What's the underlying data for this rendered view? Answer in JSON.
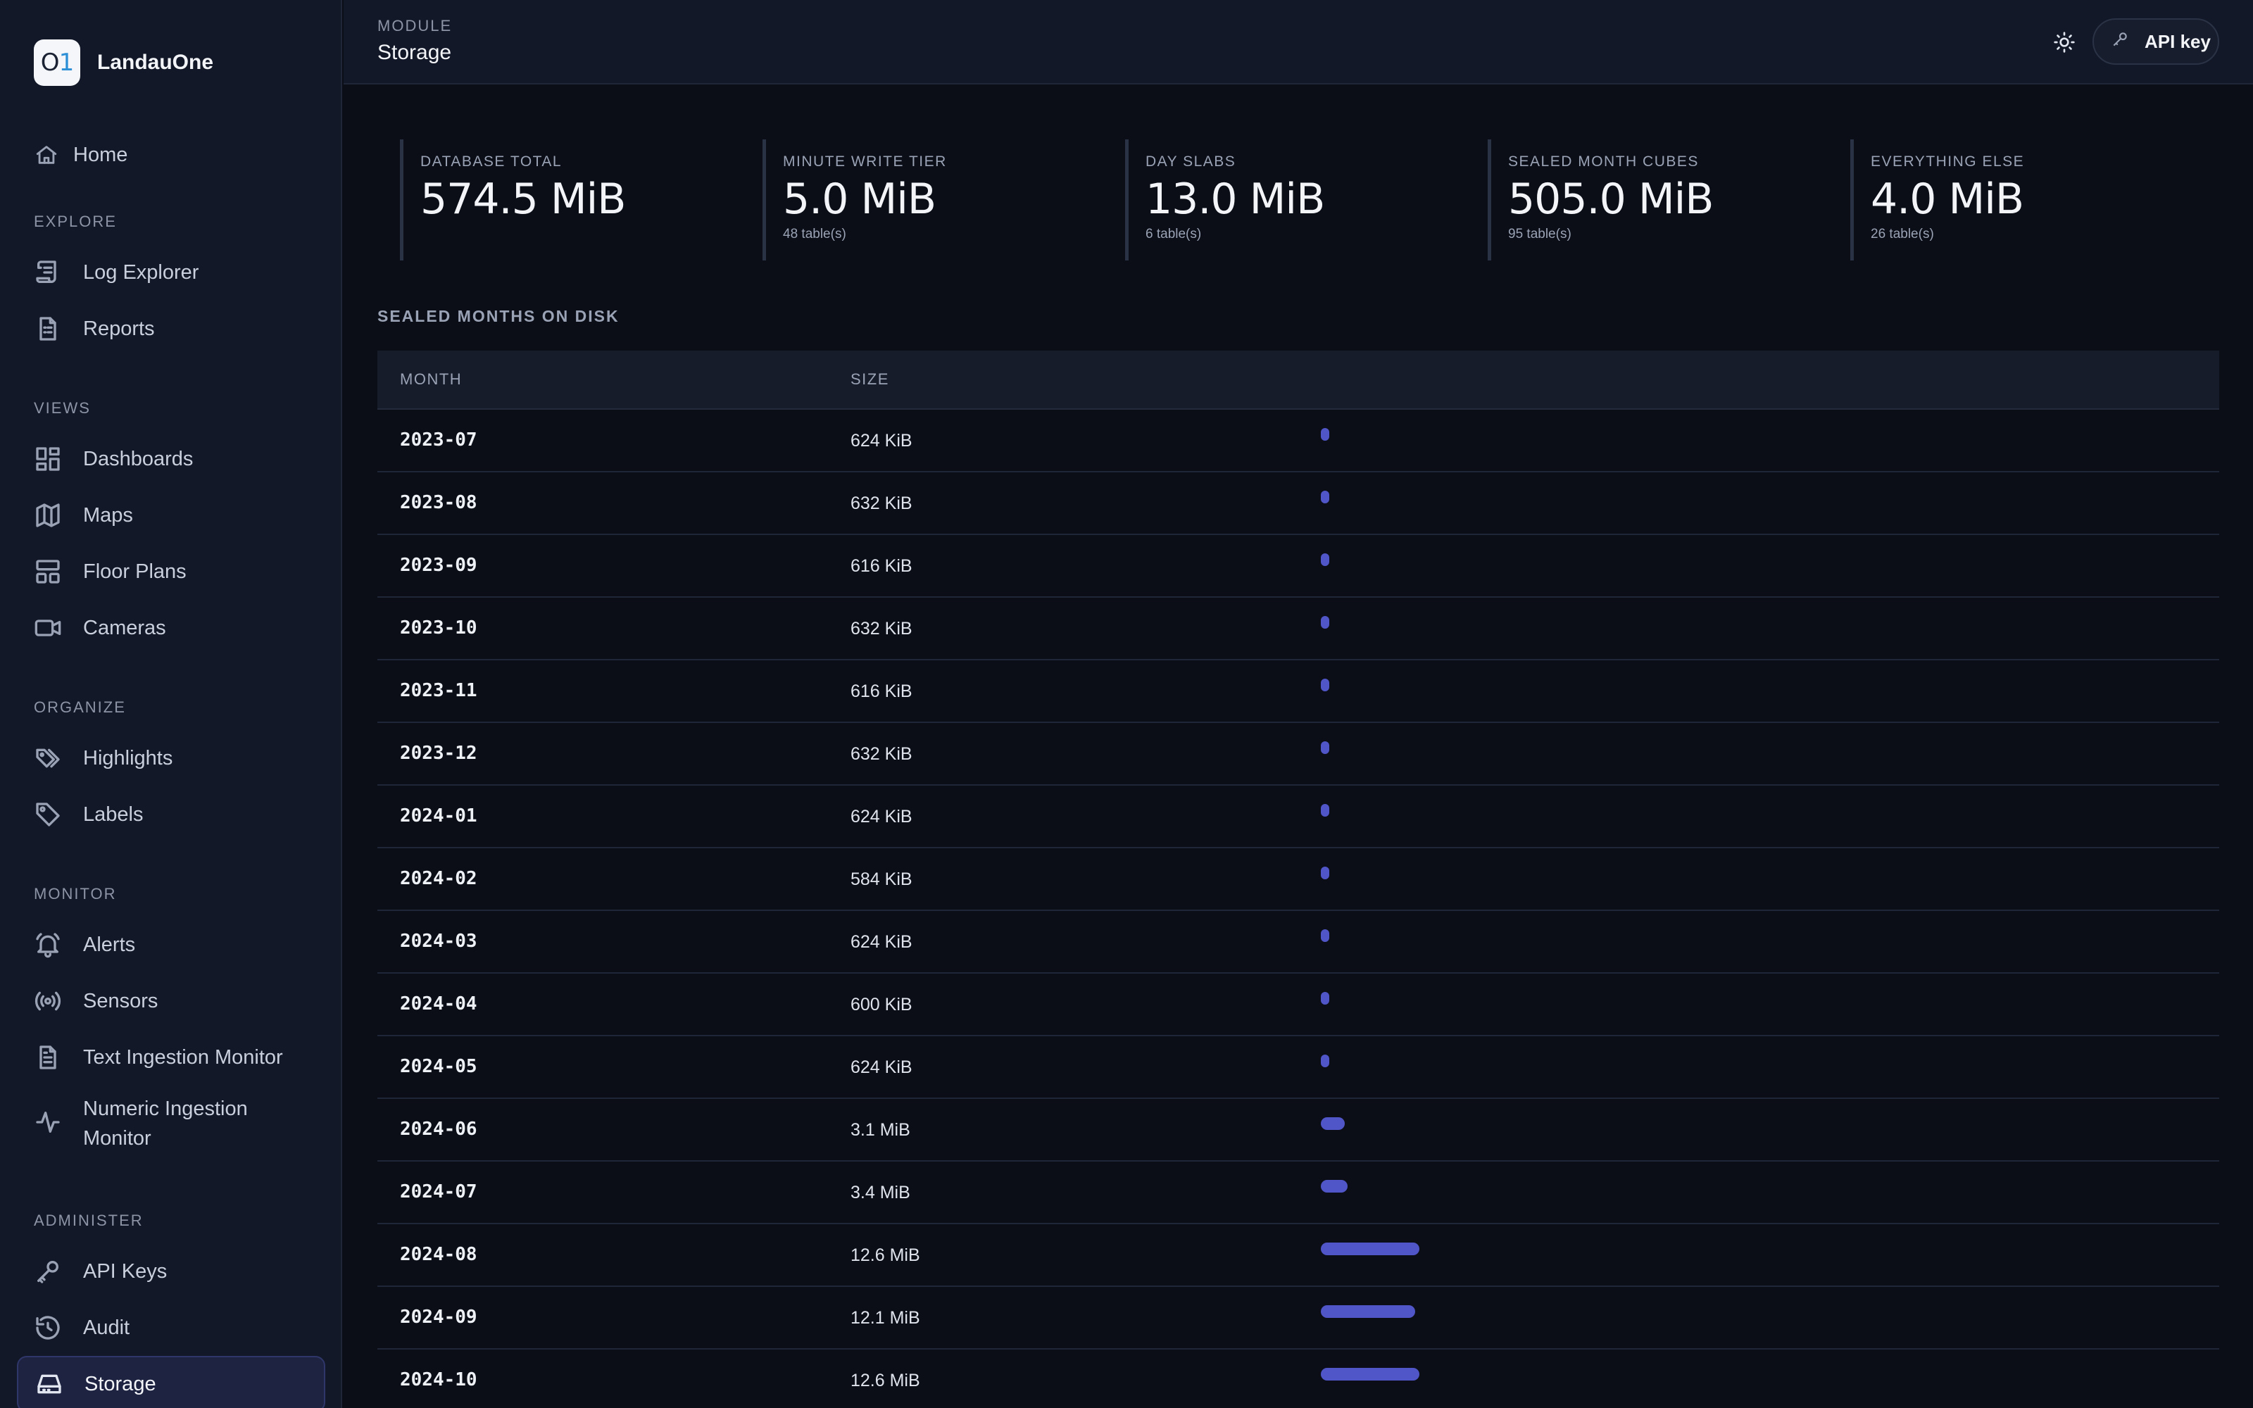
{
  "app": {
    "name": "LandauOne",
    "logo_text": "O",
    "logo_accent": "1"
  },
  "sidebar": {
    "home": {
      "label": "Home",
      "icon": "home-icon"
    },
    "sections": [
      {
        "title": "EXPLORE",
        "items": [
          {
            "label": "Log Explorer",
            "icon": "scroll-icon"
          },
          {
            "label": "Reports",
            "icon": "report-icon"
          }
        ]
      },
      {
        "title": "VIEWS",
        "items": [
          {
            "label": "Dashboards",
            "icon": "dashboard-icon"
          },
          {
            "label": "Maps",
            "icon": "map-icon"
          },
          {
            "label": "Floor Plans",
            "icon": "floorplan-icon"
          },
          {
            "label": "Cameras",
            "icon": "camera-icon"
          }
        ]
      },
      {
        "title": "ORGANIZE",
        "items": [
          {
            "label": "Highlights",
            "icon": "tags-icon"
          },
          {
            "label": "Labels",
            "icon": "tag-icon"
          }
        ]
      },
      {
        "title": "MONITOR",
        "items": [
          {
            "label": "Alerts",
            "icon": "bell-icon"
          },
          {
            "label": "Sensors",
            "icon": "broadcast-icon"
          },
          {
            "label": "Text Ingestion Monitor",
            "icon": "document-icon"
          },
          {
            "label": "Numeric Ingestion Monitor",
            "icon": "activity-icon"
          }
        ]
      },
      {
        "title": "ADMINISTER",
        "items": [
          {
            "label": "API Keys",
            "icon": "key-icon"
          },
          {
            "label": "Audit",
            "icon": "history-icon"
          },
          {
            "label": "Storage",
            "icon": "hard-drive-icon",
            "active": true
          }
        ]
      }
    ]
  },
  "header": {
    "module_label": "MODULE",
    "title": "Storage",
    "theme_icon": "sun-icon",
    "api_key_label": "API key",
    "api_key_icon": "key-icon"
  },
  "stats": [
    {
      "label": "DATABASE TOTAL",
      "value": "574.5 MiB",
      "sub": ""
    },
    {
      "label": "MINUTE WRITE TIER",
      "value": "5.0 MiB",
      "sub": "48 table(s)"
    },
    {
      "label": "DAY SLABS",
      "value": "13.0 MiB",
      "sub": "6 table(s)"
    },
    {
      "label": "SEALED MONTH CUBES",
      "value": "505.0 MiB",
      "sub": "95 table(s)"
    },
    {
      "label": "EVERYTHING ELSE",
      "value": "4.0 MiB",
      "sub": "26 table(s)"
    }
  ],
  "months_section": {
    "title": "SEALED MONTHS ON DISK",
    "columns": [
      "MONTH",
      "SIZE"
    ],
    "accent_color": "#5056c7",
    "rows": [
      {
        "month": "2023-07",
        "size": "624 KiB",
        "bytes_mib": 0.61
      },
      {
        "month": "2023-08",
        "size": "632 KiB",
        "bytes_mib": 0.62
      },
      {
        "month": "2023-09",
        "size": "616 KiB",
        "bytes_mib": 0.6
      },
      {
        "month": "2023-10",
        "size": "632 KiB",
        "bytes_mib": 0.62
      },
      {
        "month": "2023-11",
        "size": "616 KiB",
        "bytes_mib": 0.6
      },
      {
        "month": "2023-12",
        "size": "632 KiB",
        "bytes_mib": 0.62
      },
      {
        "month": "2024-01",
        "size": "624 KiB",
        "bytes_mib": 0.61
      },
      {
        "month": "2024-02",
        "size": "584 KiB",
        "bytes_mib": 0.57
      },
      {
        "month": "2024-03",
        "size": "624 KiB",
        "bytes_mib": 0.61
      },
      {
        "month": "2024-04",
        "size": "600 KiB",
        "bytes_mib": 0.59
      },
      {
        "month": "2024-05",
        "size": "624 KiB",
        "bytes_mib": 0.61
      },
      {
        "month": "2024-06",
        "size": "3.1 MiB",
        "bytes_mib": 3.1
      },
      {
        "month": "2024-07",
        "size": "3.4 MiB",
        "bytes_mib": 3.4
      },
      {
        "month": "2024-08",
        "size": "12.6 MiB",
        "bytes_mib": 12.6
      },
      {
        "month": "2024-09",
        "size": "12.1 MiB",
        "bytes_mib": 12.1
      },
      {
        "month": "2024-10",
        "size": "12.6 MiB",
        "bytes_mib": 12.6
      }
    ]
  }
}
